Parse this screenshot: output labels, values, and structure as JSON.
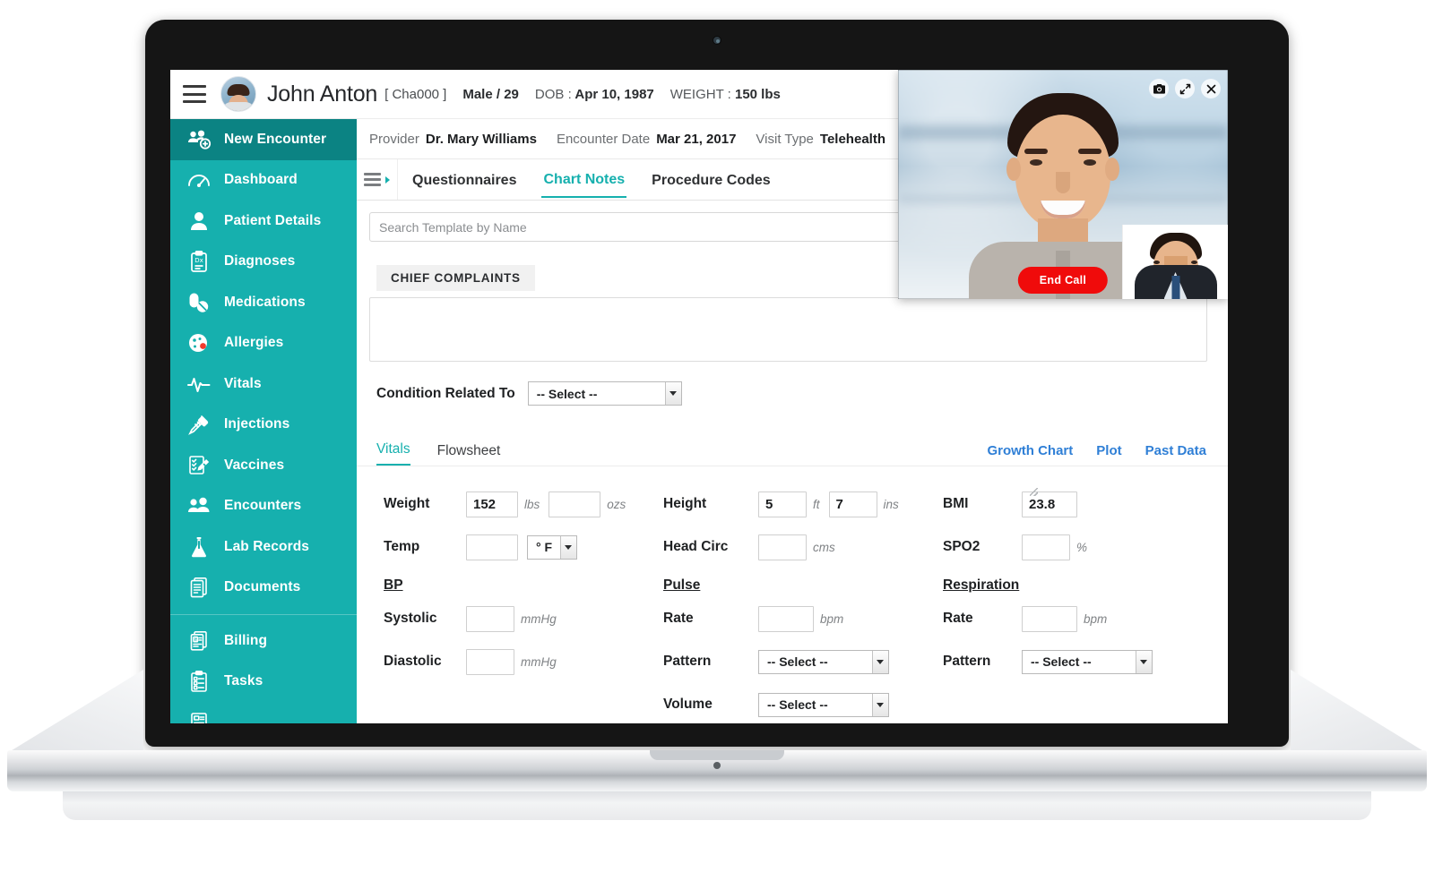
{
  "patient_bar": {
    "menu_icon": "hamburger-icon",
    "avatar_icon": "patient-avatar",
    "name": "John Anton",
    "chart_id": "[ Cha000 ]",
    "gender_age": "Male / 29",
    "dob_label": "DOB :",
    "dob_value": "Apr 10, 1987",
    "weight_label": "WEIGHT :",
    "weight_value": "150 lbs"
  },
  "sidebar": {
    "items": [
      {
        "label": "New Encounter",
        "icon": "new-encounter-icon",
        "active": true
      },
      {
        "label": "Dashboard",
        "icon": "dashboard-gauge-icon",
        "active": false
      },
      {
        "label": "Patient Details",
        "icon": "person-icon",
        "active": false
      },
      {
        "label": "Diagnoses",
        "icon": "clipboard-rx-icon",
        "active": false
      },
      {
        "label": "Medications",
        "icon": "pill-capsule-icon",
        "active": false
      },
      {
        "label": "Allergies",
        "icon": "allergy-cell-icon",
        "active": false
      },
      {
        "label": "Vitals",
        "icon": "heartbeat-icon",
        "active": false
      },
      {
        "label": "Injections",
        "icon": "syringe-icon",
        "active": false
      },
      {
        "label": "Vaccines",
        "icon": "vaccine-record-icon",
        "active": false
      },
      {
        "label": "Encounters",
        "icon": "two-people-icon",
        "active": false
      },
      {
        "label": "Lab Records",
        "icon": "flask-icon",
        "active": false
      },
      {
        "label": "Documents",
        "icon": "documents-icon",
        "active": false
      }
    ],
    "items_secondary": [
      {
        "label": "Billing",
        "icon": "invoice-icon",
        "active": false
      },
      {
        "label": "Tasks",
        "icon": "checklist-icon",
        "active": false
      }
    ]
  },
  "encounter_bar": {
    "provider_label": "Provider",
    "provider_value": "Dr. Mary Williams",
    "encounter_date_label": "Encounter Date",
    "encounter_date_value": "Mar 21, 2017",
    "visit_type_label": "Visit Type",
    "visit_type_value": "Telehealth"
  },
  "tabs": {
    "toggle_icon": "panel-toggle-icon",
    "items": [
      {
        "label": "Questionnaires",
        "active": false
      },
      {
        "label": "Chart Notes",
        "active": true
      },
      {
        "label": "Procedure Codes",
        "active": false
      }
    ]
  },
  "search": {
    "placeholder": "Search Template by Name",
    "value": ""
  },
  "chief_complaints": {
    "heading": "CHIEF COMPLAINTS",
    "value": "",
    "condition_label": "Condition Related To",
    "condition_value": "-- Select --"
  },
  "vitals": {
    "tabs": [
      {
        "label": "Vitals",
        "active": true
      },
      {
        "label": "Flowsheet",
        "active": false
      }
    ],
    "links": [
      {
        "label": "Growth Chart"
      },
      {
        "label": "Plot"
      },
      {
        "label": "Past Data"
      }
    ],
    "weight": {
      "label": "Weight",
      "lbs": "152",
      "lbs_unit": "lbs",
      "ozs": "",
      "ozs_unit": "ozs"
    },
    "temp": {
      "label": "Temp",
      "value": "",
      "unit_value": "° F"
    },
    "height": {
      "label": "Height",
      "ft": "5",
      "ft_unit": "ft",
      "ins": "7",
      "ins_unit": "ins"
    },
    "head_circ": {
      "label": "Head Circ",
      "value": "",
      "unit": "cms"
    },
    "bmi": {
      "label": "BMI",
      "value": "23.8"
    },
    "spo2": {
      "label": "SPO2",
      "value": "",
      "unit": "%"
    },
    "bp": {
      "heading": "BP",
      "systolic_label": "Systolic",
      "systolic_value": "",
      "systolic_unit": "mmHg",
      "diastolic_label": "Diastolic",
      "diastolic_value": "",
      "diastolic_unit": "mmHg"
    },
    "pulse": {
      "heading": "Pulse",
      "rate_label": "Rate",
      "rate_value": "",
      "rate_unit": "bpm",
      "pattern_label": "Pattern",
      "pattern_value": "-- Select --",
      "volume_label": "Volume",
      "volume_value": "-- Select --"
    },
    "respiration": {
      "heading": "Respiration",
      "rate_label": "Rate",
      "rate_value": "",
      "rate_unit": "bpm",
      "pattern_label": "Pattern",
      "pattern_value": "-- Select --"
    }
  },
  "video_call": {
    "snapshot_icon": "camera-icon",
    "resize_icon": "resize-arrows-icon",
    "close_icon": "close-x-icon",
    "end_call_label": "End Call"
  },
  "colors": {
    "sidebar": "#16b0ae",
    "sidebar_active": "#0b8383",
    "accent_teal": "#16b0ae",
    "link_blue": "#2f7fd6",
    "end_call_red": "#f00b0b",
    "status_green": "#7cb82f"
  }
}
